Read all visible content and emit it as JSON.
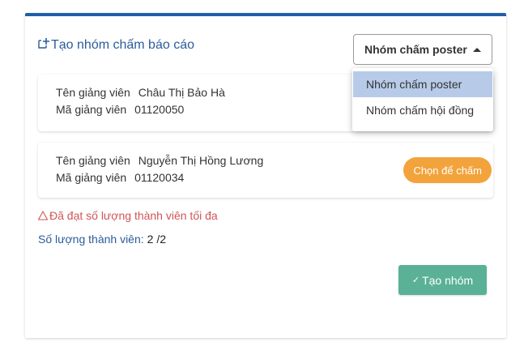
{
  "header": {
    "title": "Tạo nhóm chấm báo cáo",
    "group_type_selected": "Nhóm chấm poster"
  },
  "dropdown": {
    "options": [
      "Nhóm chấm poster",
      "Nhóm chấm hội đồng"
    ],
    "active_index": 0
  },
  "members": [
    {
      "lecturer_name_label": "Tên giảng viên",
      "lecturer_name": "Châu Thị Bảo Hà",
      "lecturer_id_label": "Mã giảng viên",
      "lecturer_id": "01120050"
    },
    {
      "lecturer_name_label": "Tên giảng viên",
      "lecturer_name": "Nguyễn Thị Hồng Lương",
      "lecturer_id_label": "Mã giảng viên",
      "lecturer_id": "01120034",
      "action_label": "Chọn để chấm"
    }
  ],
  "status": {
    "warning": "Đã đạt số lượng thành viên tối đa",
    "count_label": "Số lượng thành viên:",
    "count_value": "2 /2"
  },
  "actions": {
    "create_label": "Tạo nhóm"
  },
  "colors": {
    "accent": "#1f5fa8",
    "title": "#2a5c9a",
    "choose_button": "#f3a33c",
    "create_button": "#5ab196",
    "warning": "#d05555",
    "dropdown_active": "#b7cbe9"
  }
}
